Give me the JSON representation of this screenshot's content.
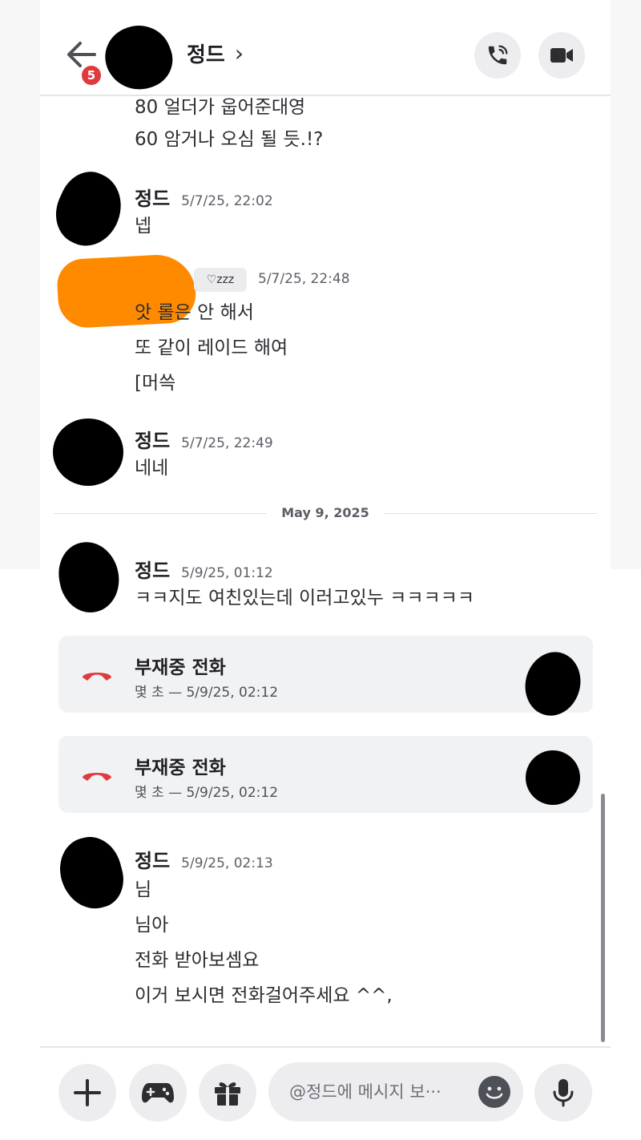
{
  "header": {
    "title": "정드",
    "chevron": "›",
    "unread_badge": "5"
  },
  "messages": {
    "partial_line_1": "80 얼더가 웁어준대영",
    "partial_line_2": "60 암거나 오심 될 듯.!?",
    "m1": {
      "author": "정드",
      "time": "5/7/25, 22:02",
      "lines": [
        "넵"
      ]
    },
    "m2": {
      "author": "",
      "status_badge": "♡zzz",
      "time": "5/7/25, 22:48",
      "lines": [
        "앗 롤은 안 해서",
        "또 같이 레이드 해여",
        "[머쓱"
      ]
    },
    "m3": {
      "author": "정드",
      "time": "5/7/25, 22:49",
      "lines": [
        "네네"
      ]
    },
    "date_divider": "May 9, 2025",
    "m4": {
      "author": "정드",
      "time": "5/9/25, 01:12",
      "lines": [
        "ㅋㅋ지도 여친있는데 이러고있누 ㅋㅋㅋㅋㅋ"
      ]
    },
    "call1": {
      "title": "부재중 전화",
      "sub": "몇 초 — 5/9/25, 02:12"
    },
    "call2": {
      "title": "부재중 전화",
      "sub": "몇 초 — 5/9/25, 02:12"
    },
    "m5": {
      "author": "정드",
      "time": "5/9/25, 02:13",
      "lines": [
        "님",
        "님아",
        "전화 받아보셈요",
        "이거 보시면 전화걸어주세요 ^^,"
      ]
    }
  },
  "composer": {
    "placeholder": "@정드에 메시지 보···"
  },
  "colors": {
    "missed_call": "#e0393e",
    "badge": "#e03a3a",
    "pill": "#ededf0"
  }
}
